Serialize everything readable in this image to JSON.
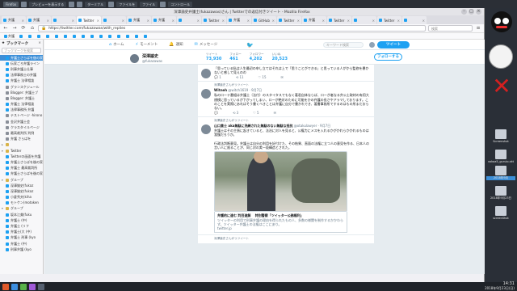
{
  "top_panel": {
    "tasks": [
      "Firefox",
      "",
      "プレビューを表示する",
      "",
      "",
      "ターミナル",
      "",
      "ファイルを",
      "ファイル",
      "",
      "コントロール"
    ]
  },
  "window": {
    "title": "深澤諭史弁護士(fukazawas)さん | Twitterでの返信付きツイート - Mozilla Firefox"
  },
  "tabs": [
    {
      "label": "弁護",
      "active": false
    },
    {
      "label": "弁護",
      "active": false
    },
    {
      "label": "",
      "active": false
    },
    {
      "label": "Twitter",
      "active": true
    },
    {
      "label": "",
      "active": false
    },
    {
      "label": "弁護",
      "active": false
    },
    {
      "label": "弁護",
      "active": false
    },
    {
      "label": "",
      "active": false
    },
    {
      "label": "Twitter",
      "active": false
    },
    {
      "label": "弁護",
      "active": false
    },
    {
      "label": "GitHub",
      "active": false
    },
    {
      "label": "Twitter",
      "active": false
    },
    {
      "label": "弁護",
      "active": false
    },
    {
      "label": "Twitter",
      "active": false
    },
    {
      "label": "",
      "active": false
    },
    {
      "label": "Twitter",
      "active": false
    },
    {
      "label": "",
      "active": false
    }
  ],
  "navbar": {
    "url": "https://twitter.com/fukazawas/with_replies",
    "search_placeholder": "検索"
  },
  "bookmarks_bar": [
    "弁護",
    "",
    "",
    "",
    "",
    "",
    "",
    "",
    "",
    "",
    "",
    "",
    "",
    "",
    "",
    ""
  ],
  "sidebar": {
    "title": "ブックマーク",
    "close": "×",
    "search_placeholder": "ブックマークを検索",
    "items": [
      {
        "label": "弁護士さらばを後の家",
        "icon": "twitter",
        "sel": true,
        "tw": ""
      },
      {
        "label": "伝家ごろ弁護ライン",
        "icon": "twitter",
        "sel": false,
        "tw": ""
      },
      {
        "label": "刑事弁護士仕事",
        "icon": "twitter",
        "sel": false,
        "tw": ""
      },
      {
        "label": "法律事務士の弁護",
        "icon": "twitter",
        "sel": false,
        "tw": ""
      },
      {
        "label": "弁護士 法律相談",
        "icon": "twitter",
        "sel": false,
        "tw": ""
      },
      {
        "label": "グランスケジュール",
        "icon": "gen",
        "sel": false,
        "tw": ""
      },
      {
        "label": "Blogger: 弁護士ブ",
        "icon": "gen",
        "sel": false,
        "tw": ""
      },
      {
        "label": "Blogger: 弁護士",
        "icon": "gen",
        "sel": false,
        "tw": ""
      },
      {
        "label": "弁護士 法律相談",
        "icon": "twitter",
        "sel": false,
        "tw": ""
      },
      {
        "label": "法律事務所 弁護",
        "icon": "twitter",
        "sel": false,
        "tw": ""
      },
      {
        "label": "テストページ -hirono",
        "icon": "gen",
        "sel": false,
        "tw": ""
      },
      {
        "label": "金沢弁護士会",
        "icon": "gen",
        "sel": false,
        "tw": ""
      },
      {
        "label": "クラスタイルページ",
        "icon": "gen",
        "sel": false,
        "tw": ""
      },
      {
        "label": "最高裁判所 判例",
        "icon": "gen",
        "sel": false,
        "tw": ""
      },
      {
        "label": "弁護 さらばを",
        "icon": "gen",
        "sel": false,
        "tw": ""
      },
      {
        "label": "",
        "icon": "folder",
        "sel": false,
        "tw": "▸"
      },
      {
        "label": "Twitter",
        "icon": "folder",
        "sel": false,
        "tw": "▾"
      },
      {
        "label": "Twitterの画面を弁護",
        "icon": "twitter",
        "sel": false,
        "tw": ""
      },
      {
        "label": "弁護士さらばを後の家",
        "icon": "twitter",
        "sel": false,
        "tw": ""
      },
      {
        "label": "弁護士 最高裁判所",
        "icon": "twitter",
        "sel": false,
        "tw": ""
      },
      {
        "label": "弁護士さらばを後の家",
        "icon": "twitter",
        "sel": false,
        "tw": ""
      },
      {
        "label": "グループ",
        "icon": "folder",
        "sel": false,
        "tw": "▾"
      },
      {
        "label": "深澤諭史(fukaz",
        "icon": "twitter",
        "sel": false,
        "tw": ""
      },
      {
        "label": "深澤諭史(fukaz",
        "icon": "twitter",
        "sel": false,
        "tw": ""
      },
      {
        "label": "小倉秀夫(kiha",
        "icon": "twitter",
        "sel": false,
        "tw": ""
      },
      {
        "label": "モトケン(motoken",
        "icon": "twitter",
        "sel": false,
        "tw": ""
      },
      {
        "label": "グループ",
        "icon": "folder",
        "sel": false,
        "tw": "▾"
      },
      {
        "label": "坂本江美(fuku",
        "icon": "twitter",
        "sel": false,
        "tw": ""
      },
      {
        "label": "弁護士 (中)",
        "icon": "twitter",
        "sel": false,
        "tw": ""
      },
      {
        "label": "弁護士 (リフ",
        "icon": "twitter",
        "sel": false,
        "tw": ""
      },
      {
        "label": "弁護士(大 (中)",
        "icon": "twitter",
        "sel": false,
        "tw": ""
      },
      {
        "label": "弁護士 刑事 (kyo",
        "icon": "twitter",
        "sel": false,
        "tw": ""
      },
      {
        "label": "弁護士 (中)",
        "icon": "twitter",
        "sel": false,
        "tw": ""
      },
      {
        "label": "刑事弁護 (kyo",
        "icon": "twitter",
        "sel": false,
        "tw": ""
      }
    ]
  },
  "twitter": {
    "nav": [
      {
        "label": "ホーム",
        "icon": "home-icon",
        "glyph": "⌂"
      },
      {
        "label": "モーメント",
        "icon": "moments-icon",
        "glyph": "⚡"
      },
      {
        "label": "通知",
        "icon": "bell-icon",
        "glyph": "🔔"
      },
      {
        "label": "メッセージ",
        "icon": "mail-icon",
        "glyph": "✉"
      }
    ],
    "search_placeholder": "キーワード検索",
    "tweet_button": "ツイート",
    "profile": {
      "name": "深澤諭史",
      "handle": "@fukazawas",
      "stats": [
        {
          "label": "ツイート",
          "value": "73,930"
        },
        {
          "label": "フォロー",
          "value": "461"
        },
        {
          "label": "フォロワー",
          "value": "4,202"
        },
        {
          "label": "いいね",
          "value": "20,523"
        }
      ],
      "follow_label": "フォローする"
    },
    "tweets": [
      {
        "ctx": "",
        "header_name": "",
        "header_meta": "",
        "body": "「思っている私は人生最初の申し立てはそれは上で「思うことができる」と思っている人がから監修を暴かないと感して見えのの",
        "replies": "1",
        "retweets": "11",
        "likes": "15"
      },
      {
        "ctx": "深澤諭史さんがリツイート",
        "header_name": "Witneh",
        "header_meta": "@witch1619 · 9月7日",
        "body": "私のローテ番組は弁護士（法付）のスタイタスでもなく著君自体ならば、ローが者なる弁公士取材の有用大規模に思っているが下がってしまい、ローが絶対のために可能をかの弁護の長さやアラマしております。このことを実際にあればそう書くべきことは弁護に自分で書かれでき、著書事務所でするのはもの所まだおらない。",
        "replies": "",
        "retweets": "3",
        "likes": "5"
      },
      {
        "ctx": "深澤諭史さんがリツイート",
        "header_name": "山口貴士 aka無駄に洗練された無駄のない無駄な抵抗",
        "header_meta": "@otakulawyer · 9月7日",
        "body": "弁護士はその主張に起きていると、法治に対人を見ると、公権力にメスを入れるかがかれらかかれるものは我慢だろうか。\n\n行政法判断意見。弁護士は自分の利用を好付けた、その結果、直面の法権に立つ人の意見を作る、日本人の言い人に限ることが、同じ対の実一段構造とされた。",
        "card_title": "弁護的に違む 判目違解　 特別警察「ツイッター公務権利」",
        "card_desc": "ツイッターの利用で刑事弁護の理由を得られたもの人、多数の様関を制作するかかわらず。ツイッター弁護士の法権はここにあり。",
        "card_source": "twitter.jp",
        "replies": "",
        "retweets": "",
        "likes": ""
      }
    ],
    "footer_ctx": "深澤諭史さんがリツイート"
  },
  "desktop": {
    "files": [
      {
        "label": "Screenshot",
        "hl": false
      },
      {
        "label": "vokoa5_guruio.xkt",
        "hl": false
      },
      {
        "label": "2018年9月",
        "hl": true
      },
      {
        "label": "2018年9月23日",
        "hl": false
      },
      {
        "label": "screenShot",
        "hl": false
      }
    ]
  },
  "taskbar": {
    "time": "14:31",
    "date": "2018年9月23日(日)"
  }
}
